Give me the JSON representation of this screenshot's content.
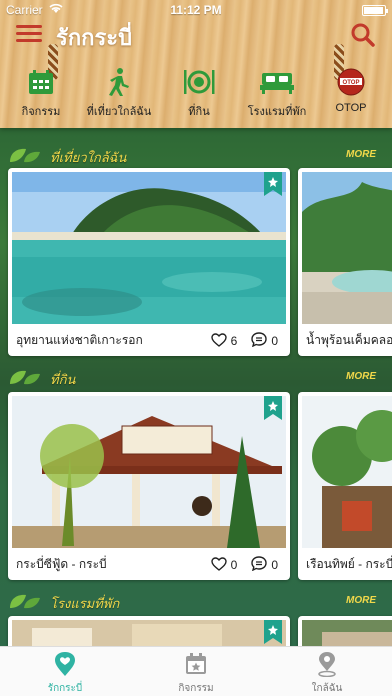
{
  "status": {
    "carrier": "Carrier",
    "time": "11:12 PM"
  },
  "header": {
    "title": "รักกระบี่"
  },
  "categories": [
    {
      "label": "กิจกรรม",
      "icon": "calendar-icon"
    },
    {
      "label": "ที่เที่ยวใกล้ฉัน",
      "icon": "walking-person-icon"
    },
    {
      "label": "ที่กิน",
      "icon": "plate-cutlery-icon"
    },
    {
      "label": "โรงแรมที่พัก",
      "icon": "bed-icon"
    },
    {
      "label": "OTOP",
      "icon": "otop-logo-icon"
    }
  ],
  "sections": [
    {
      "title": "ที่เที่ยวใกล้ฉัน",
      "more": "MORE",
      "cards": [
        {
          "caption": "อุทยานแห่งชาติเกาะรอก",
          "likes": "6",
          "comments": "0"
        },
        {
          "caption": "น้ำพุร้อนเค็มคลอ"
        }
      ]
    },
    {
      "title": "ที่กิน",
      "more": "MORE",
      "cards": [
        {
          "caption": "กระบี่ซีฟู้ด - กระบี่",
          "likes": "0",
          "comments": "0"
        },
        {
          "caption": "เรือนทิพย์ - กระบี่"
        }
      ]
    },
    {
      "title": "โรงแรมที่พัก",
      "more": "MORE",
      "cards": []
    }
  ],
  "tabs": [
    {
      "label": "รักกระบี่",
      "icon": "heart-pin-icon",
      "active": true
    },
    {
      "label": "กิจกรรม",
      "icon": "calendar-star-icon",
      "active": false
    },
    {
      "label": "ใกล้ฉัน",
      "icon": "location-pin-icon",
      "active": false
    }
  ],
  "colors": {
    "accent": "#2fb3a3",
    "brand_red": "#c23a2b",
    "section_title": "#f2d84a",
    "icon_green": "#2f9a3a"
  }
}
